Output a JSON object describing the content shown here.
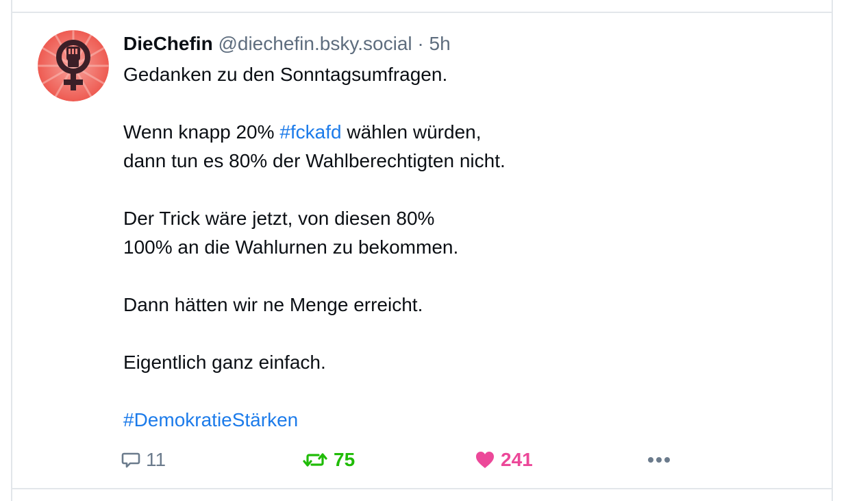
{
  "post": {
    "author": {
      "display_name": "DieChefin",
      "handle": "@diechefin.bsky.social",
      "avatar_icon": "raised-fist-venus-icon"
    },
    "separator": "·",
    "time": "5h",
    "body": {
      "line1": "Gedanken zu den Sonntagsumfragen.",
      "line2_prefix": "Wenn knapp 20% ",
      "line2_hashtag": "#fckafd",
      "line2_suffix": " wählen würden,",
      "line3": "dann tun es 80% der Wahlberechtigten nicht.",
      "line4": "Der Trick wäre jetzt, von diesen 80%",
      "line5": "100% an die Wahlurnen zu bekommen.",
      "line6": "Dann hätten wir ne Menge erreicht.",
      "line7": "Eigentlich ganz einfach.",
      "hashtag_final": "#DemokratieStärken"
    },
    "actions": {
      "reply_count": "11",
      "repost_count": "75",
      "like_count": "241",
      "reply_icon": "speech-bubble-icon",
      "repost_icon": "repost-arrows-icon",
      "like_icon": "heart-icon",
      "more_icon": "ellipsis-icon"
    }
  },
  "colors": {
    "link": "#1c7bea",
    "repost_active": "#20bc07",
    "like_active": "#ec4899",
    "muted": "#6b7b8c",
    "border": "#e2e6ea"
  }
}
